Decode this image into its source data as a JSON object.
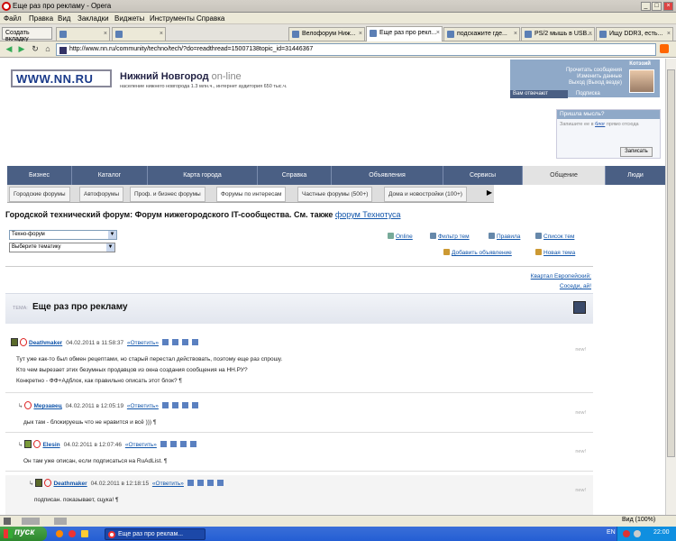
{
  "window": {
    "title": "Еще раз про рекламу - Opera",
    "controls": [
      "_",
      "□",
      "×"
    ]
  },
  "menu": [
    "Файл",
    "Правка",
    "Вид",
    "Закладки",
    "Виджеты",
    "Инструменты",
    "Справка"
  ],
  "tabs": {
    "new_tab_label": "Создать вкладку",
    "items": [
      {
        "label": "",
        "active": false
      },
      {
        "label": "Велофорум Ниж...",
        "active": false
      },
      {
        "label": "Еще раз про рекл...",
        "active": true
      },
      {
        "label": "подскажите где...",
        "active": false
      },
      {
        "label": "PS/2 мышь в USB...",
        "active": false
      },
      {
        "label": "Ищу DDR3, есть...",
        "active": false
      }
    ]
  },
  "address": {
    "url": "http://www.nn.ru/community/techno/tech/?do=readthread=15007138topic_id=31446367"
  },
  "site": {
    "logo": "WWW.NN.RU",
    "logo_small": "нижний новгород",
    "name": "Нижний Новгород",
    "online": "on-line",
    "subtitle": "население нижнего новгорода 1.3 млн.ч., интернет аудитория 650 тыс.ч.",
    "user": {
      "name": "Котэзий",
      "links": [
        "Прочитать сообщения",
        "Изменить данные",
        "Выход (Выход везде)"
      ],
      "tabs": [
        "Вам отвечают",
        "Подписка"
      ]
    },
    "thought": {
      "title": "Пришла мысль?",
      "hint_pre": "Запишите ее в",
      "hint_link": "блог",
      "hint_post": "прямо отсюда",
      "button": "Записать"
    }
  },
  "mainnav": [
    "Бизнес",
    "Каталог",
    "Карта города",
    "Справка",
    "Объявления",
    "Сервисы",
    "Общение",
    "Люди"
  ],
  "subnav": [
    "Городские форумы",
    "Автофорумы",
    "Проф. и бизнес форумы",
    "Форумы по интересам",
    "Частные форумы (500+)",
    "Дома и новостройки (100+)"
  ],
  "forum": {
    "title_pre": "Городской технический форум: Форум нижегородского IT-сообщества. См. также",
    "title_link": "форум Технотуса",
    "select_value": "Техно-форум",
    "theme_placeholder": "Выберите тематику",
    "tools": {
      "online": "Online",
      "filter": "Фильтр тем",
      "rules": "Правила",
      "topics": "Список тем",
      "add_ad": "Добавить объявление",
      "new_topic": "Новая тема"
    },
    "quarter_link": "Квартал Европейский:",
    "neighbors": "Соседи, ай!",
    "topic_label": "ТЕМА:",
    "topic": "Еще раз про рекламу"
  },
  "posts": [
    {
      "author": "Deathmaker",
      "date": "04.02.2011 в 11:58:37",
      "reply": "«Ответить»",
      "new": "new!",
      "lines": [
        "Тут уже как-то был обмен рецептами, но старый перестал действовать, поэтому еще раз спрошу.",
        "Кто чем вырезает этих безумных продавцов из окна создания сообщения на НН.РУ?",
        "Конкретно - ФФ+Адблок, как правильно описать этот блок? ¶"
      ]
    },
    {
      "author": "Мерзавец",
      "date": "04.02.2011 в 12:05:19",
      "reply": "«Ответить»",
      "new": "new!",
      "lines": [
        "дык там - блокируешь что не нравится и всё ))) ¶"
      ]
    },
    {
      "author": "Elesin",
      "date": "04.02.2011 в 12:07:46",
      "reply": "«Ответить»",
      "new": "new!",
      "lines": [
        "Он там уже описан, если подписаться на RuAdList. ¶"
      ]
    },
    {
      "author": "Deathmaker",
      "date": "04.02.2011 в 12:18:15",
      "reply": "«Ответить»",
      "new": "new!",
      "lines": [
        "подписан. показывает, сцука! ¶"
      ]
    }
  ],
  "status": {
    "zoom": "Вид (100%)"
  },
  "taskbar": {
    "start": "пуск",
    "item": "Еще раз про реклам...",
    "lang": "EN",
    "time": "22:00"
  }
}
